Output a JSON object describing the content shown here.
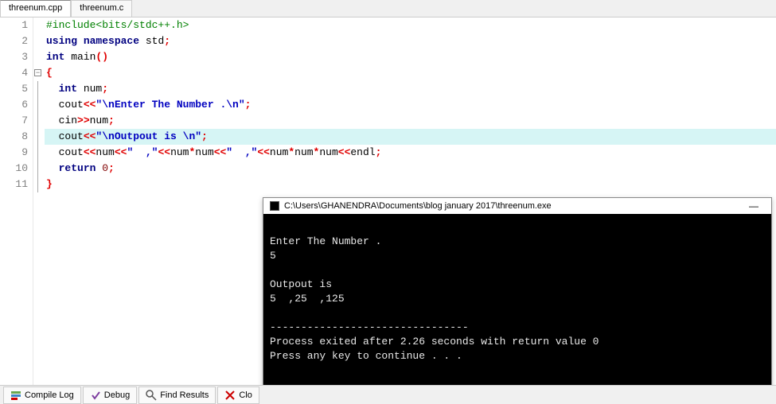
{
  "tabs": [
    {
      "label": "threenum.cpp",
      "active": true
    },
    {
      "label": "threenum.c",
      "active": false
    }
  ],
  "code": {
    "lines": [
      {
        "n": 1,
        "tokens": [
          [
            "pre",
            "#include<bits/stdc++.h>"
          ]
        ]
      },
      {
        "n": 2,
        "tokens": [
          [
            "kw",
            "using"
          ],
          [
            "",
            " "
          ],
          [
            "kw",
            "namespace"
          ],
          [
            "ident",
            " std"
          ],
          [
            "op",
            ";"
          ]
        ]
      },
      {
        "n": 3,
        "tokens": [
          [
            "kw",
            "int"
          ],
          [
            "ident",
            " main"
          ],
          [
            "op",
            "()"
          ]
        ]
      },
      {
        "n": 4,
        "fold": true,
        "tokens": [
          [
            "brace",
            "{"
          ]
        ]
      },
      {
        "n": 5,
        "tokens": [
          [
            "ident",
            "  "
          ],
          [
            "kw",
            "int"
          ],
          [
            "ident",
            " num"
          ],
          [
            "op",
            ";"
          ]
        ]
      },
      {
        "n": 6,
        "tokens": [
          [
            "ident",
            "  cout"
          ],
          [
            "op",
            "<<"
          ],
          [
            "str",
            "\"\\nEnter The Number .\\n\""
          ],
          [
            "op",
            ";"
          ]
        ]
      },
      {
        "n": 7,
        "tokens": [
          [
            "ident",
            "  cin"
          ],
          [
            "op",
            ">>"
          ],
          [
            "ident",
            "num"
          ],
          [
            "op",
            ";"
          ]
        ]
      },
      {
        "n": 8,
        "hl": true,
        "tokens": [
          [
            "ident",
            "  cout"
          ],
          [
            "op",
            "<<"
          ],
          [
            "str",
            "\"\\nOutpout is \\n\""
          ],
          [
            "op",
            ";"
          ]
        ]
      },
      {
        "n": 9,
        "tokens": [
          [
            "ident",
            "  cout"
          ],
          [
            "op",
            "<<"
          ],
          [
            "ident",
            "num"
          ],
          [
            "op",
            "<<"
          ],
          [
            "str",
            "\"  ,\""
          ],
          [
            "op",
            "<<"
          ],
          [
            "ident",
            "num"
          ],
          [
            "op",
            "*"
          ],
          [
            "ident",
            "num"
          ],
          [
            "op",
            "<<"
          ],
          [
            "str",
            "\"  ,\""
          ],
          [
            "op",
            "<<"
          ],
          [
            "ident",
            "num"
          ],
          [
            "op",
            "*"
          ],
          [
            "ident",
            "num"
          ],
          [
            "op",
            "*"
          ],
          [
            "ident",
            "num"
          ],
          [
            "op",
            "<<"
          ],
          [
            "ident",
            "endl"
          ],
          [
            "op",
            ";"
          ]
        ]
      },
      {
        "n": 10,
        "tokens": [
          [
            "ident",
            "  "
          ],
          [
            "kw",
            "return"
          ],
          [
            "ident",
            " "
          ],
          [
            "num",
            "0"
          ],
          [
            "op",
            ";"
          ]
        ]
      },
      {
        "n": 11,
        "tokens": [
          [
            "brace",
            "}"
          ]
        ]
      }
    ]
  },
  "console": {
    "title": "C:\\Users\\GHANENDRA\\Documents\\blog january 2017\\threenum.exe",
    "minimize": "—",
    "lines": [
      "",
      "Enter The Number .",
      "5",
      "",
      "Outpout is",
      "5  ,25  ,125",
      "",
      "--------------------------------",
      "Process exited after 2.26 seconds with return value 0",
      "Press any key to continue . . ."
    ]
  },
  "bottom": {
    "compile_log": "Compile Log",
    "debug": "Debug",
    "find_results": "Find Results",
    "close": "Clo"
  }
}
